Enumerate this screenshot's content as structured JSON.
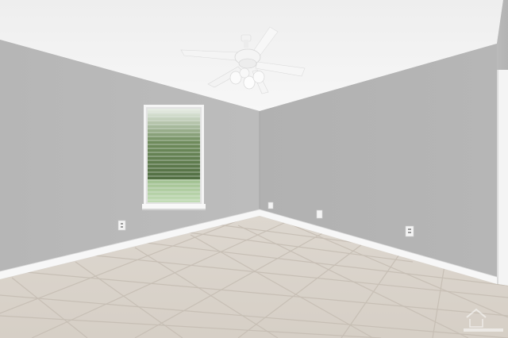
{
  "scene": {
    "kind": "interior-photo",
    "subject": "empty-room",
    "fixtures": [
      "ceiling-fan-with-light-kit",
      "window-with-blinds",
      "electrical-outlet",
      "baseboard"
    ],
    "floor": "ceramic-tile",
    "colors": {
      "ceiling": "#f3f3f3",
      "left_wall": "#b9b9b9",
      "back_wall": "#b4b4b4",
      "right_wall": "#b7b7b7",
      "floor": "#dbd4cc",
      "grout": "#c9c1b8",
      "baseboard": "#f6f6f6",
      "window_foliage": "#5a7a48",
      "window_lawn": "#a9c89a"
    }
  },
  "watermark": {
    "kind": "logo-watermark"
  }
}
